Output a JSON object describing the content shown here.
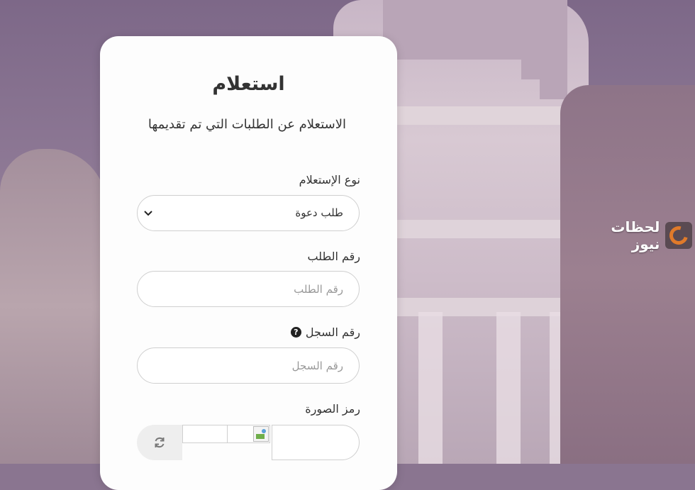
{
  "logo": {
    "text": "لحظات نيوز"
  },
  "form": {
    "title": "استعلام",
    "subtitle": "الاستعلام عن الطلبات التي تم تقديمها",
    "inquiry_type": {
      "label": "نوع الإستعلام",
      "selected": "طلب دعوة"
    },
    "request_number": {
      "label": "رقم الطلب",
      "placeholder": "رقم الطلب"
    },
    "record_number": {
      "label": "رقم السجل",
      "placeholder": "رقم السجل"
    },
    "captcha": {
      "label": "رمز الصورة"
    }
  },
  "colors": {
    "card_bg": "#fdfdfd",
    "field_border": "#cfcfcf",
    "logo_accent": "#e07a2a"
  }
}
